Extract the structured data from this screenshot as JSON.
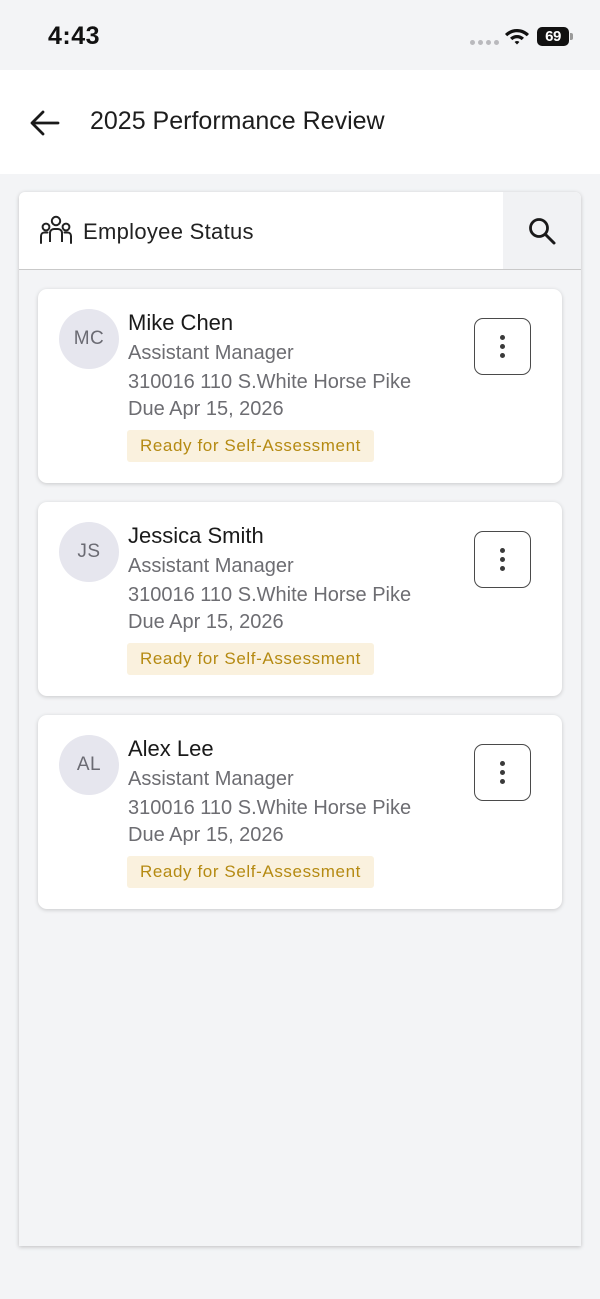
{
  "status_bar": {
    "time": "4:43",
    "battery": "69"
  },
  "header": {
    "title": "2025 Performance Review",
    "back_icon": "arrow-left-icon"
  },
  "panel": {
    "title": "Employee Status",
    "title_icon": "people-icon",
    "search_icon": "search-icon"
  },
  "employees": [
    {
      "initials": "MC",
      "name": "Mike Chen",
      "role": "Assistant Manager",
      "address": "310016 110 S.White Horse Pike",
      "due": "Due Apr 15, 2026",
      "status": "Ready for Self-Assessment"
    },
    {
      "initials": "JS",
      "name": "Jessica Smith",
      "role": "Assistant Manager",
      "address": "310016 110 S.White Horse Pike",
      "due": "Due Apr 15, 2026",
      "status": "Ready for Self-Assessment"
    },
    {
      "initials": "AL",
      "name": "Alex Lee",
      "role": "Assistant Manager",
      "address": "310016 110 S.White Horse Pike",
      "due": "Due Apr 15, 2026",
      "status": "Ready for Self-Assessment"
    }
  ],
  "colors": {
    "badge_bg": "#faf1de",
    "badge_text": "#b58a12",
    "avatar_bg": "#e6e6ee",
    "page_bg": "#f3f4f6"
  }
}
